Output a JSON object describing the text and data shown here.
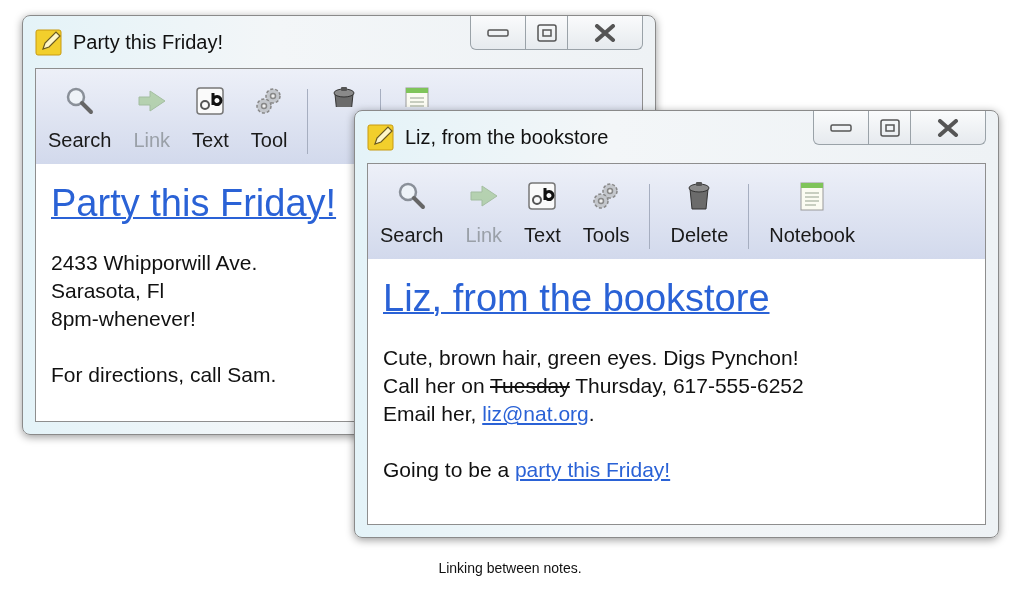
{
  "windows": [
    {
      "title": "Party this Friday!",
      "toolbar": [
        {
          "kind": "search",
          "label": "Search",
          "disabled": false
        },
        {
          "kind": "link",
          "label": "Link",
          "disabled": true
        },
        {
          "kind": "text",
          "label": "Text",
          "disabled": false
        },
        {
          "kind": "tools",
          "label": "Tool",
          "disabled": false
        },
        {
          "kind": "delete",
          "separator_before": true,
          "disabled": false
        },
        {
          "kind": "notebook",
          "separator_before": true,
          "disabled": false
        }
      ],
      "heading": "Party this Friday!",
      "paragraphs": [
        [
          [
            {
              "kind": "text",
              "text": "2433 Whipporwill Ave."
            }
          ],
          [
            {
              "kind": "text",
              "text": "Sarasota, Fl"
            }
          ],
          [
            {
              "kind": "text",
              "text": "8pm-whenever!"
            }
          ]
        ],
        [
          [
            {
              "kind": "text",
              "text": "For directions, call Sam."
            }
          ]
        ]
      ]
    },
    {
      "title": "Liz, from the bookstore",
      "toolbar": [
        {
          "kind": "search",
          "label": "Search",
          "disabled": false
        },
        {
          "kind": "link",
          "label": "Link",
          "disabled": true
        },
        {
          "kind": "text",
          "label": "Text",
          "disabled": false
        },
        {
          "kind": "tools",
          "label": "Tools",
          "disabled": false
        },
        {
          "kind": "delete",
          "label": "Delete",
          "separator_before": true,
          "disabled": false
        },
        {
          "kind": "notebook",
          "label": "Notebook",
          "separator_before": true,
          "disabled": false
        }
      ],
      "heading": "Liz, from the bookstore",
      "paragraphs": [
        [
          [
            {
              "kind": "text",
              "text": "Cute, brown hair, green eyes. Digs Pynchon!"
            }
          ],
          [
            {
              "kind": "text",
              "text": "Call her on "
            },
            {
              "kind": "strike",
              "text": "Tuesday"
            },
            {
              "kind": "text",
              "text": " Thursday, 617-555-6252"
            }
          ],
          [
            {
              "kind": "text",
              "text": "Email her, "
            },
            {
              "kind": "link",
              "text": "liz@nat.org"
            },
            {
              "kind": "text",
              "text": "."
            }
          ]
        ],
        [
          [
            {
              "kind": "text",
              "text": "Going to be a "
            },
            {
              "kind": "link",
              "text": "party this Friday!"
            }
          ]
        ]
      ]
    }
  ],
  "caption": "Linking between notes."
}
